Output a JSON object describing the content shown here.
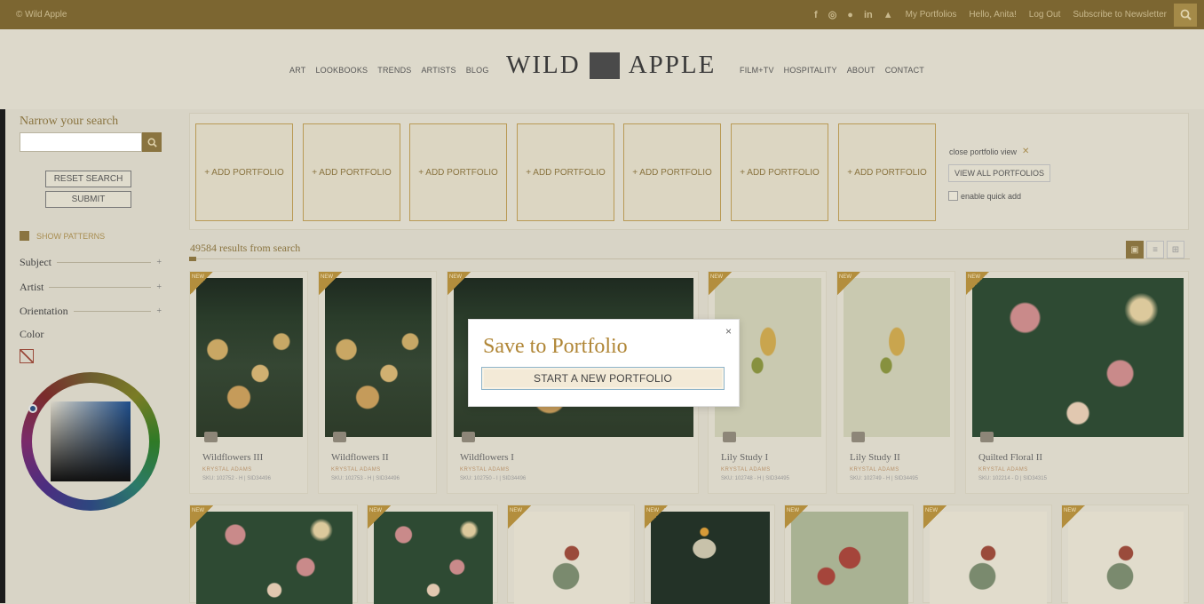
{
  "topbar": {
    "copyright": "© Wild Apple",
    "social": [
      "f",
      "◎",
      "●",
      "in",
      "▲"
    ],
    "links": [
      "My Portfolios",
      "Hello, Anita!",
      "Log Out",
      "Subscribe to Newsletter"
    ]
  },
  "nav": {
    "left": [
      "ART",
      "LOOKBOOKS",
      "TRENDS",
      "ARTISTS",
      "BLOG"
    ],
    "right": [
      "FILM+TV",
      "HOSPITALITY",
      "ABOUT",
      "CONTACT"
    ],
    "logo_left": "WILD",
    "logo_right": "APPLE"
  },
  "sidebar": {
    "narrow_label": "Narrow your search",
    "search_value": "",
    "reset_label": "RESET SEARCH",
    "submit_label": "SUBMIT",
    "show_patterns": "SHOW PATTERNS",
    "facets": [
      "Subject",
      "Artist",
      "Orientation"
    ],
    "color_label": "Color"
  },
  "portfolio_bar": {
    "tiles": [
      "+ ADD PORTFOLIO",
      "+ ADD PORTFOLIO",
      "+ ADD PORTFOLIO",
      "+ ADD PORTFOLIO",
      "+ ADD PORTFOLIO",
      "+ ADD PORTFOLIO",
      "+ ADD PORTFOLIO"
    ],
    "close_view": "close portfolio view",
    "view_all": "VIEW ALL PORTFOLIOS",
    "quick_add": "enable quick add"
  },
  "results": {
    "count_text": "49584 results from search"
  },
  "cards_row1": [
    {
      "title": "Wildflowers III",
      "artist": "KRYSTAL ADAMS",
      "sku": "SKU: 102752 - H | SID34496",
      "new": "NEW"
    },
    {
      "title": "Wildflowers II",
      "artist": "KRYSTAL ADAMS",
      "sku": "SKU: 102753 - H | SID34496",
      "new": "NEW"
    },
    {
      "title": "Wildflowers I",
      "artist": "KRYSTAL ADAMS",
      "sku": "SKU: 102750 - I | SID34496",
      "new": "NEW"
    },
    {
      "title": "Lily Study I",
      "artist": "KRYSTAL ADAMS",
      "sku": "SKU: 102748 - H | SID34495",
      "new": "NEW"
    },
    {
      "title": "Lily Study II",
      "artist": "KRYSTAL ADAMS",
      "sku": "SKU: 102749 - H | SID34495",
      "new": "NEW"
    },
    {
      "title": "Quilted Floral II",
      "artist": "KRYSTAL ADAMS",
      "sku": "SKU: 102214 - D | SID34315",
      "new": "NEW"
    }
  ],
  "cards_row2_new": [
    "NEW",
    "NEW",
    "NEW",
    "NEW",
    "NEW",
    "NEW",
    "NEW"
  ],
  "modal": {
    "title": "Save to Portfolio",
    "close": "×",
    "start_button": "START A NEW PORTFOLIO"
  },
  "colors": {
    "brand_gold": "#b08636",
    "topbar": "#7c6631"
  },
  "icons": [
    "search-icon",
    "grid-view-icon",
    "list-view-icon",
    "portfolio-view-icon",
    "close-icon",
    "thumbnail-portfolio-icon"
  ]
}
